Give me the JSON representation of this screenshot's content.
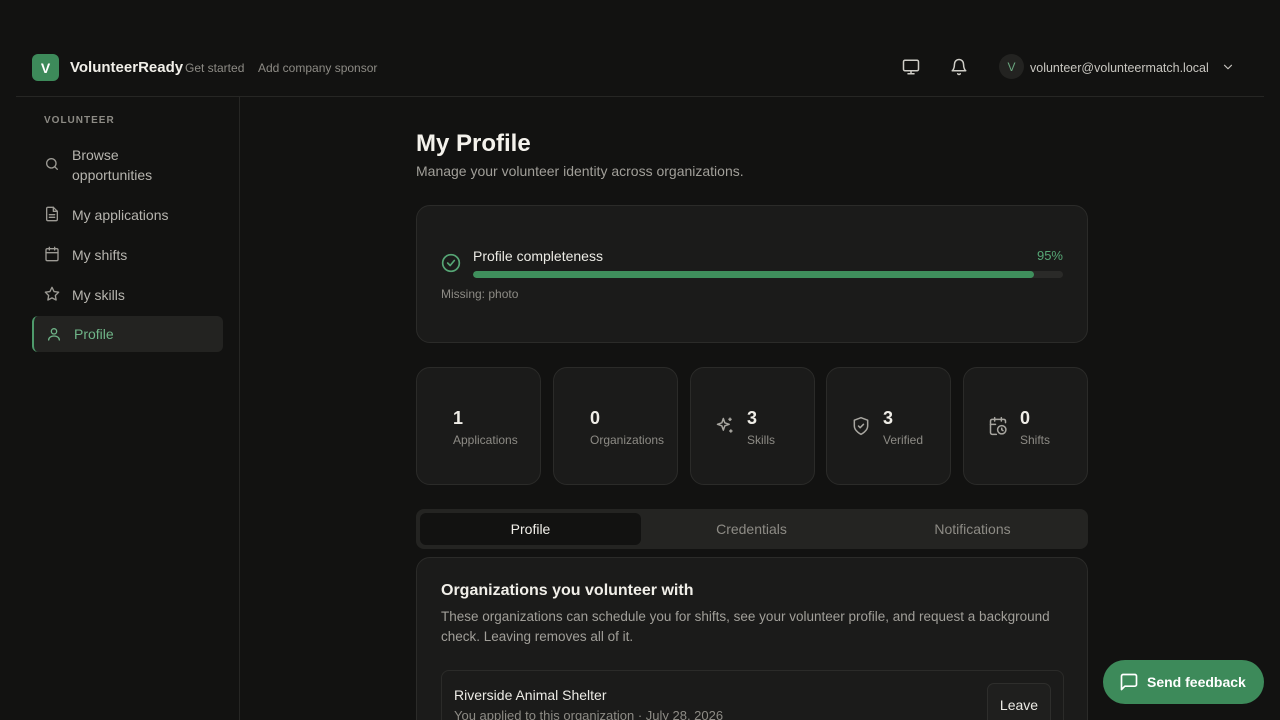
{
  "header": {
    "logo_letter": "V",
    "brand": "VolunteerReady",
    "links": [
      "Get started",
      "Add company sponsor"
    ],
    "avatar_letter": "V",
    "email": "volunteer@volunteermatch.local"
  },
  "sidebar": {
    "section_label": "VOLUNTEER",
    "items": [
      {
        "label": "Browse opportunities",
        "icon": "search-icon"
      },
      {
        "label": "My applications",
        "icon": "document-icon"
      },
      {
        "label": "My shifts",
        "icon": "calendar-icon"
      },
      {
        "label": "My skills",
        "icon": "star-icon"
      },
      {
        "label": "Profile",
        "icon": "user-icon",
        "active": true
      }
    ]
  },
  "page": {
    "title": "My Profile",
    "subtitle": "Manage your volunteer identity across organizations."
  },
  "completeness": {
    "label": "Profile completeness",
    "percent_text": "95%",
    "percent": 95,
    "missing": "Missing: photo"
  },
  "stats": [
    {
      "value": "1",
      "label": "Applications",
      "icon": null
    },
    {
      "value": "0",
      "label": "Organizations",
      "icon": null
    },
    {
      "value": "3",
      "label": "Skills",
      "icon": "sparkles-icon"
    },
    {
      "value": "3",
      "label": "Verified",
      "icon": "shield-check-icon"
    },
    {
      "value": "0",
      "label": "Shifts",
      "icon": "calendar-clock-icon"
    }
  ],
  "tabs": [
    {
      "label": "Profile",
      "active": true
    },
    {
      "label": "Credentials"
    },
    {
      "label": "Notifications"
    }
  ],
  "organizations": {
    "title": "Organizations you volunteer with",
    "description": "These organizations can schedule you for shifts, see your volunteer profile, and request a background check. Leaving removes all of it.",
    "items": [
      {
        "name": "Riverside Animal Shelter",
        "meta": "You applied to this organization · July 28, 2026",
        "action": "Leave"
      }
    ]
  },
  "feedback": {
    "label": "Send feedback"
  },
  "colors": {
    "accent": "#3d8a5a",
    "background": "#121211",
    "card": "#1b1b1a"
  }
}
